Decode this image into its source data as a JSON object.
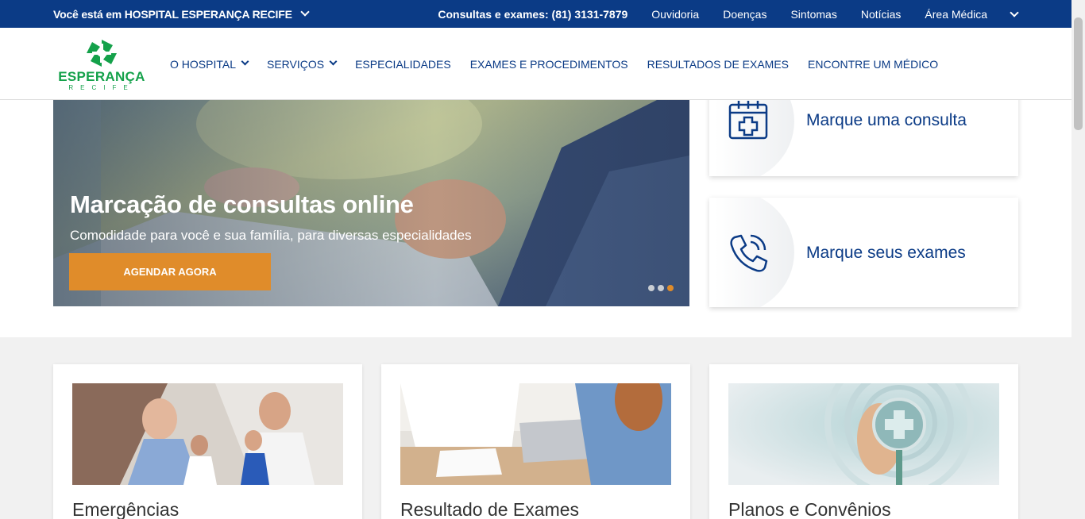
{
  "topbar": {
    "location_label": "Você está em HOSPITAL ESPERANÇA RECIFE",
    "links": [
      "Consultas e exames: (81) 3131-7879",
      "Ouvidoria",
      "Doenças",
      "Sintomas",
      "Notícias",
      "Área Médica"
    ]
  },
  "logo": {
    "name": "ESPERANÇA",
    "sub": "RECIFE"
  },
  "nav": {
    "items": [
      "O HOSPITAL",
      "SERVIÇOS",
      "ESPECIALIDADES",
      "EXAMES E PROCEDIMENTOS",
      "RESULTADOS DE EXAMES",
      "ENCONTRE UM MÉDICO"
    ]
  },
  "hero": {
    "title": "Marcação de consultas online",
    "subtitle": "Comodidade para você e sua família, para diversas especialidades",
    "button": "AGENDAR AGORA",
    "active_slide": 3,
    "slide_count": 3
  },
  "side_cards": [
    {
      "label": "Marque uma consulta",
      "icon": "calendar-plus-icon"
    },
    {
      "label": "Marque seus exames",
      "icon": "phone-ringing-icon"
    }
  ],
  "cards": [
    {
      "title": "Emergências"
    },
    {
      "title": "Resultado de Exames"
    },
    {
      "title": "Planos e Convênios"
    }
  ],
  "colors": {
    "brand_blue": "#0b3b86",
    "brand_green": "#14a14a",
    "accent_orange": "#e08c2a"
  }
}
